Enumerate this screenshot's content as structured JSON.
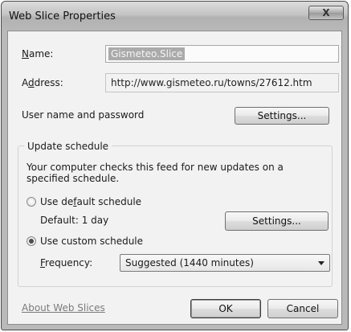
{
  "window": {
    "title": "Web Slice Properties",
    "close_symbol": "X"
  },
  "name": {
    "label": "Name:",
    "value": "Gismeteo.Slice"
  },
  "address": {
    "label": "Address:",
    "value": "http://www.gismeteo.ru/towns/27612.htm"
  },
  "credentials": {
    "label": "User name and password",
    "settings_label": "Settings..."
  },
  "update_schedule": {
    "title": "Update schedule",
    "description_line1": "Your computer checks this feed for new updates on a",
    "description_line2": "specified schedule.",
    "default_option": "Use default schedule",
    "default_selected": false,
    "default_info": "Default: 1 day",
    "settings_label": "Settings...",
    "custom_option": "Use custom schedule",
    "custom_selected": true,
    "frequency_label": "Frequency:",
    "frequency_value": "Suggested (1440 minutes)"
  },
  "footer": {
    "about_link": "About Web Slices",
    "ok_label": "OK",
    "cancel_label": "Cancel"
  },
  "colors": {
    "titlebar": "#c4c4c4",
    "body": "#f2f2f2",
    "link": "#7b7b7b"
  }
}
